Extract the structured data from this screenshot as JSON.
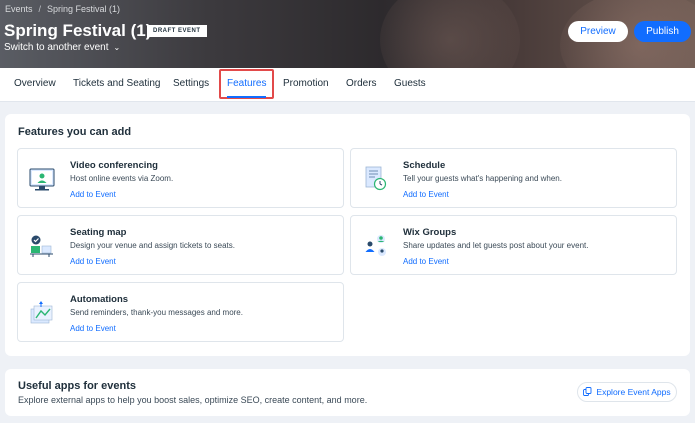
{
  "header": {
    "breadcrumb": [
      "Events",
      "Spring Festival (1)"
    ],
    "breadcrumb_separator": "/",
    "title": "Spring Festival (1)",
    "status_badge": "DRAFT EVENT",
    "switch_event_label": "Switch to another event",
    "preview_label": "Preview",
    "publish_label": "Publish"
  },
  "tabs": [
    {
      "label": "Overview",
      "active": false
    },
    {
      "label": "Tickets and Seating",
      "active": false
    },
    {
      "label": "Settings",
      "active": false
    },
    {
      "label": "Features",
      "active": true
    },
    {
      "label": "Promotion",
      "active": false
    },
    {
      "label": "Orders",
      "active": false
    },
    {
      "label": "Guests",
      "active": false
    }
  ],
  "features_section": {
    "title": "Features you can add",
    "items": [
      {
        "name": "Video conferencing",
        "description": "Host online events via Zoom.",
        "link": "Add to Event",
        "icon": "video-conference-icon"
      },
      {
        "name": "Schedule",
        "description": "Tell your guests what's happening and when.",
        "link": "Add to Event",
        "icon": "schedule-icon"
      },
      {
        "name": "Seating map",
        "description": "Design your venue and assign tickets to seats.",
        "link": "Add to Event",
        "icon": "seating-map-icon"
      },
      {
        "name": "Wix Groups",
        "description": "Share updates and let guests post about your event.",
        "link": "Add to Event",
        "icon": "groups-icon"
      },
      {
        "name": "Automations",
        "description": "Send reminders, thank-you messages and more.",
        "link": "Add to Event",
        "icon": "automations-icon"
      }
    ]
  },
  "apps_section": {
    "title": "Useful apps for events",
    "description": "Explore external apps to help you boost sales, optimize SEO, create content, and more.",
    "explore_label": "Explore Event Apps"
  },
  "colors": {
    "accent": "#116dff",
    "highlight_box": "#e24a4a",
    "page_bg": "#eef1f6"
  }
}
